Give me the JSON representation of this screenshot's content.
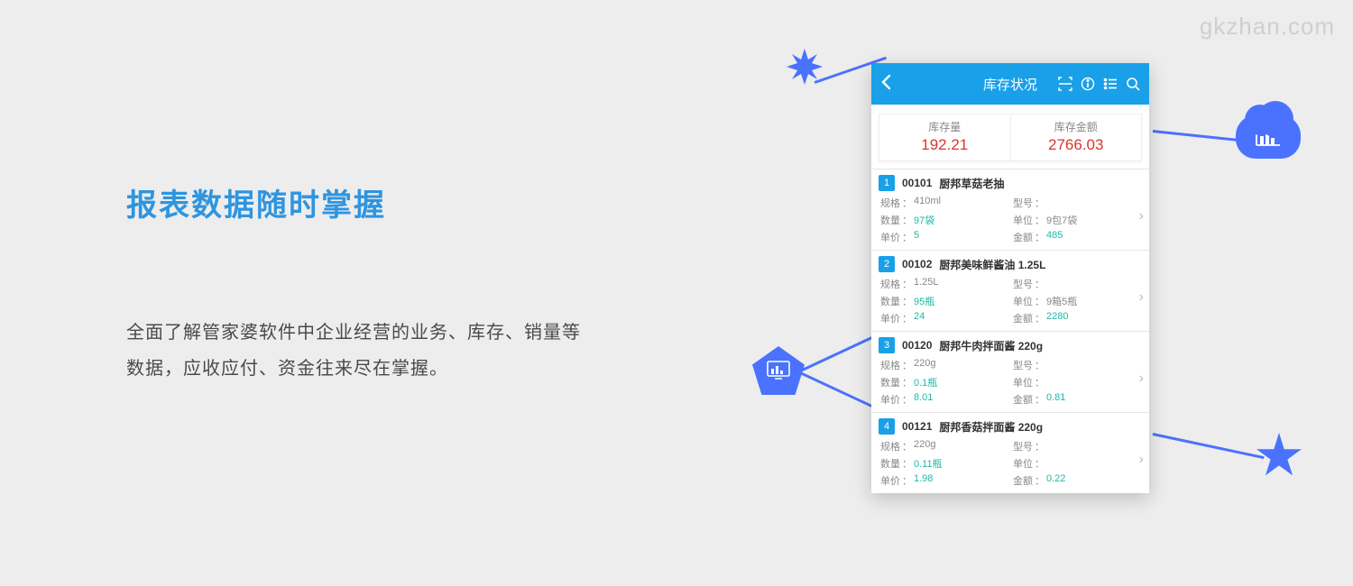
{
  "watermark": "gkzhan.com",
  "heading": "报表数据随时掌握",
  "description": "全面了解管家婆软件中企业经营的业务、库存、销量等数据，应收应付、资金往来尽在掌握。",
  "app": {
    "title": "库存状况",
    "icons": [
      "scan-icon",
      "info-icon",
      "list-icon",
      "search-icon"
    ],
    "summary": {
      "qty_label": "库存量",
      "qty_value": "192.21",
      "amount_label": "库存金额",
      "amount_value": "2766.03"
    },
    "labels": {
      "spec": "规格",
      "model": "型号",
      "qty": "数量",
      "unit": "单位",
      "price": "单价",
      "amount": "金额"
    },
    "items": [
      {
        "num": "1",
        "code": "00101",
        "name": "厨邦草菇老抽",
        "spec": "410ml",
        "model": "",
        "qty": "97袋",
        "unit": "9包7袋",
        "price": "5",
        "amount": "485"
      },
      {
        "num": "2",
        "code": "00102",
        "name": "厨邦美味鲜酱油 1.25L",
        "spec": "1.25L",
        "model": "",
        "qty": "95瓶",
        "unit": "9箱5瓶",
        "price": "24",
        "amount": "2280"
      },
      {
        "num": "3",
        "code": "00120",
        "name": "厨邦牛肉拌面酱 220g",
        "spec": "220g",
        "model": "",
        "qty": "0.1瓶",
        "unit": "",
        "price": "8.01",
        "amount": "0.81"
      },
      {
        "num": "4",
        "code": "00121",
        "name": "厨邦香菇拌面酱 220g",
        "spec": "220g",
        "model": "",
        "qty": "0.11瓶",
        "unit": "",
        "price": "1.98",
        "amount": "0.22"
      }
    ]
  }
}
